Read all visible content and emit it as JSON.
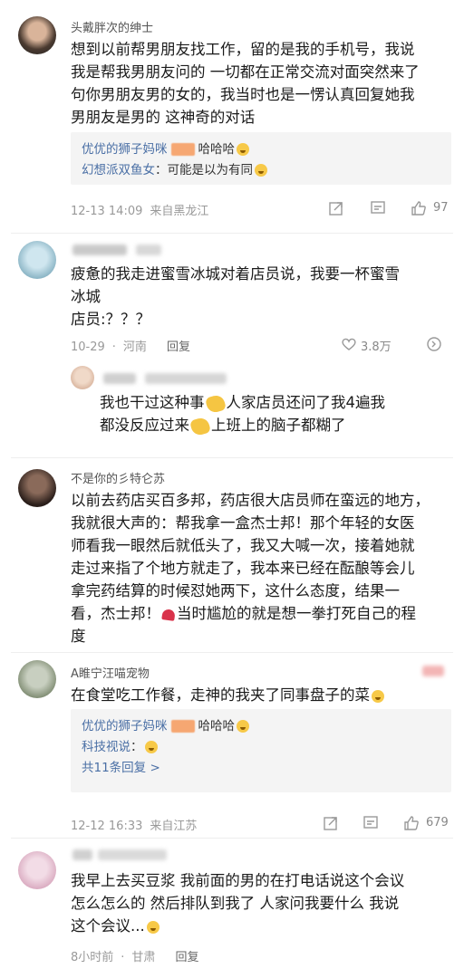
{
  "comments": [
    {
      "username": "头戴胖次的绅士",
      "lines": [
        "想到以前帮男朋友找工作，留的是我的手机号，我说",
        "我是帮我男朋友问的 一切都在正常交流对面突然来了",
        "句你男朋友男的女的，我当时也是一愣认真回复她我",
        "男朋友是男的   这神奇的对话"
      ],
      "replies": [
        {
          "name": "优优的狮子妈咪",
          "text": "哈哈哈"
        },
        {
          "name": "幻想派双鱼女",
          "text": "可能是以为有同"
        }
      ],
      "time": "12-13 14:09",
      "location": "来自黑龙江",
      "likes": "97"
    },
    {
      "lines": [
        "疲惫的我走进蜜雪冰城对着店员说，我要一杯蜜雪",
        "冰城",
        "店员:？？？"
      ],
      "time": "10-29",
      "location": "河南",
      "reply_label": "回复",
      "likes": "3.8万",
      "nested": {
        "line1a": "我也干过这种事",
        "line1b": "人家店员还问了我4遍我",
        "line2a": "都没反应过来",
        "line2b": "上班上的脑子都糊了"
      }
    },
    {
      "username": "不是你的彡特仑苏",
      "lines": [
        "以前去药店买百多邦，药店很大店员师在蛮远的地方，",
        "我就很大声的：帮我拿一盒杰士邦！那个年轻的女医",
        "师看我一眼然后就低头了，我又大喊一次，接着她就",
        "走过来指了个地方就走了，我本来已经在酝酿等会儿",
        "拿完药结算的时候怼她两下，这什么态度，结果一",
        "看，杰士邦！",
        "当时尴尬的就是想一拳打死自己的程",
        "度"
      ]
    },
    {
      "username": "A睢宁汪喵宠物",
      "lines": [
        "在食堂吃工作餐，走神的我夹了同事盘子的菜"
      ],
      "replies": [
        {
          "name": "优优的狮子妈咪",
          "text": "哈哈哈"
        },
        {
          "name": "科技视说",
          "text": ""
        }
      ],
      "more": "共11条回复 >",
      "time": "12-12 16:33",
      "location": "来自江苏",
      "likes": "679"
    },
    {
      "lines": [
        "我早上去买豆浆 我前面的男的在打电话说这个会议",
        "怎么怎么的 然后排队到我了 人家问我要什么 我说",
        "这个会议..."
      ],
      "time": "8小时前",
      "location": "甘肃",
      "reply_label": "回复"
    }
  ],
  "colors": {
    "link": "#4a6fa5",
    "meta": "#999999",
    "orange_blot": "#f6a772"
  }
}
